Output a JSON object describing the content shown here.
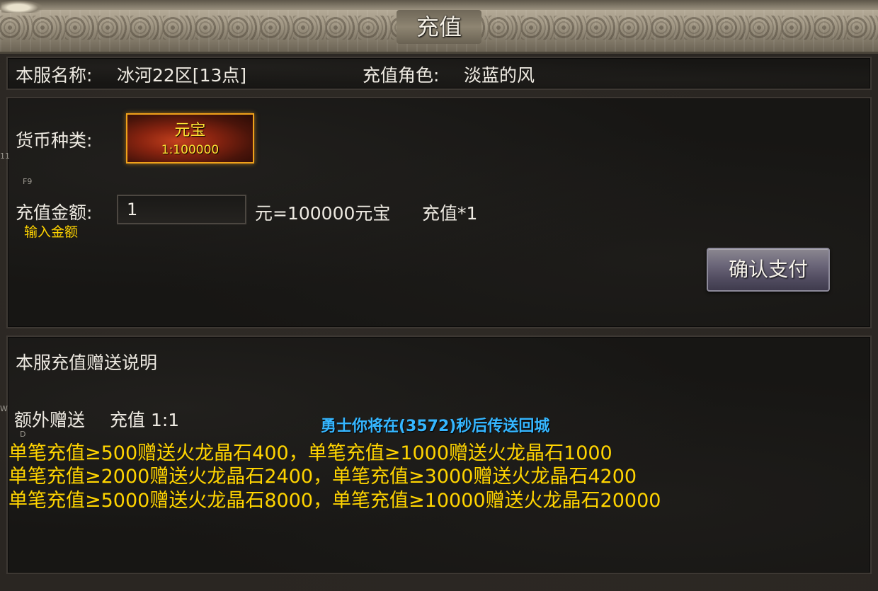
{
  "window": {
    "title": "充值"
  },
  "info": {
    "server_label": "本服名称:",
    "server_value": "冰河22区[13点]",
    "role_label": "充值角色:",
    "role_value": "淡蓝的风"
  },
  "currency": {
    "label": "货币种类:",
    "name": "元宝",
    "rate": "1:100000"
  },
  "amount": {
    "label": "充值金额:",
    "hint": "输入金额",
    "value": "1",
    "conversion": "元=100000元宝",
    "multiplier": "充值*1"
  },
  "confirm_label": "确认支付",
  "side_markers": {
    "a": "11",
    "b": "F9",
    "c": "W",
    "d": "D"
  },
  "description": {
    "heading": "本服充值赠送说明",
    "extra_label": "额外赠送",
    "extra_value": "充值 1:1",
    "lines": [
      "单笔充值≥500赠送火龙晶石400，单笔充值≥1000赠送火龙晶石1000",
      "单笔充值≥2000赠送火龙晶石2400，单笔充值≥3000赠送火龙晶石4200",
      "单笔充值≥5000赠送火龙晶石8000，单笔充值≥10000赠送火龙晶石20000"
    ]
  },
  "countdown": "勇士你将在(3572)秒后传送回城",
  "colors": {
    "gold_text": "#ffd400",
    "countdown_blue": "#35b6ff",
    "frame_stone": "#a49a87"
  }
}
